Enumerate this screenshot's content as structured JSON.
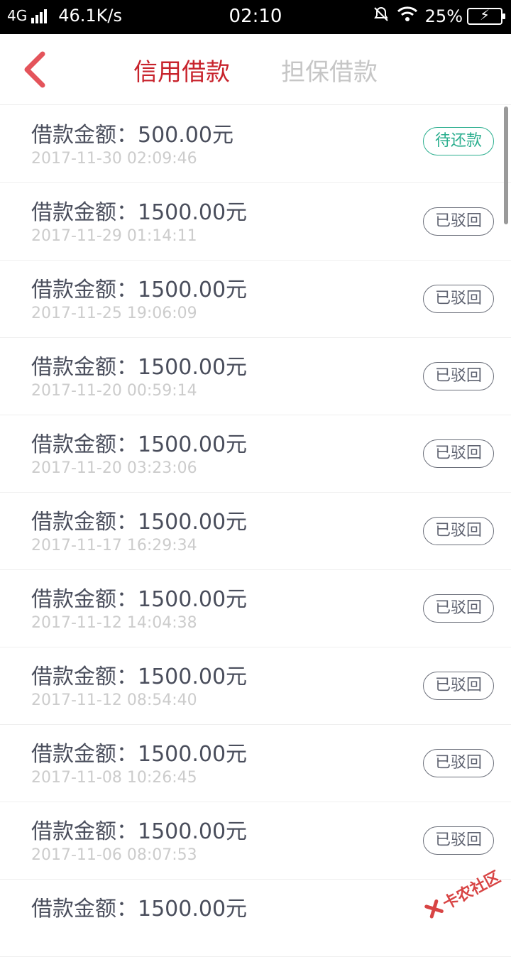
{
  "status_bar": {
    "network": "4G",
    "speed": "46.1K/s",
    "time": "02:10",
    "battery": "25%"
  },
  "header": {
    "tabs": [
      {
        "label": "信用借款",
        "active": true
      },
      {
        "label": "担保借款",
        "active": false
      }
    ]
  },
  "loans": [
    {
      "amount": "借款金额：500.00元",
      "date": "2017-11-30 02:09:46",
      "status": "待还款"
    },
    {
      "amount": "借款金额：1500.00元",
      "date": "2017-11-29 01:14:11",
      "status": "已驳回"
    },
    {
      "amount": "借款金额：1500.00元",
      "date": "2017-11-25 19:06:09",
      "status": "已驳回"
    },
    {
      "amount": "借款金额：1500.00元",
      "date": "2017-11-20 00:59:14",
      "status": "已驳回"
    },
    {
      "amount": "借款金额：1500.00元",
      "date": "2017-11-20 03:23:06",
      "status": "已驳回"
    },
    {
      "amount": "借款金额：1500.00元",
      "date": "2017-11-17 16:29:34",
      "status": "已驳回"
    },
    {
      "amount": "借款金额：1500.00元",
      "date": "2017-11-12 14:04:38",
      "status": "已驳回"
    },
    {
      "amount": "借款金额：1500.00元",
      "date": "2017-11-12 08:54:40",
      "status": "已驳回"
    },
    {
      "amount": "借款金额：1500.00元",
      "date": "2017-11-08 10:26:45",
      "status": "已驳回"
    },
    {
      "amount": "借款金额：1500.00元",
      "date": "2017-11-06 08:07:53",
      "status": "已驳回"
    },
    {
      "amount": "借款金额：1500.00元",
      "date": "",
      "status": ""
    }
  ],
  "watermark": {
    "text": "卡农社区"
  },
  "colors": {
    "accent": "#c8232c",
    "pending": "#2aae8e",
    "muted": "#c6c6c6"
  }
}
